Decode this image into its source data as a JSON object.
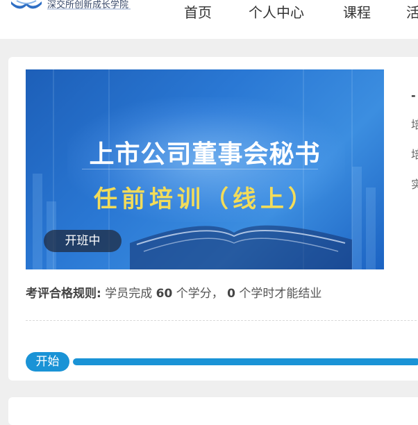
{
  "header": {
    "logo_text": "深交所创新成长学院",
    "nav": [
      "首页",
      "个人中心",
      "课程",
      "活"
    ]
  },
  "banner": {
    "title_line1": "上市公司董事会秘书",
    "title_line2": "任前培训（线上）",
    "status_badge": "开班中"
  },
  "course_info": {
    "fragments": [
      "-",
      "培",
      "培",
      "实"
    ]
  },
  "rule": {
    "label": "考评合格规则:",
    "pre": " 学员完成 ",
    "credits": "60",
    "mid": " 个学分， ",
    "hours": "0",
    "post": " 个学时才能结业"
  },
  "progress": {
    "label": "开始",
    "fill_fraction": 1.0
  },
  "colors": {
    "accent": "#1a93d6",
    "banner_blue": "#2a78d4",
    "banner_yellow": "#f2dc5a"
  }
}
